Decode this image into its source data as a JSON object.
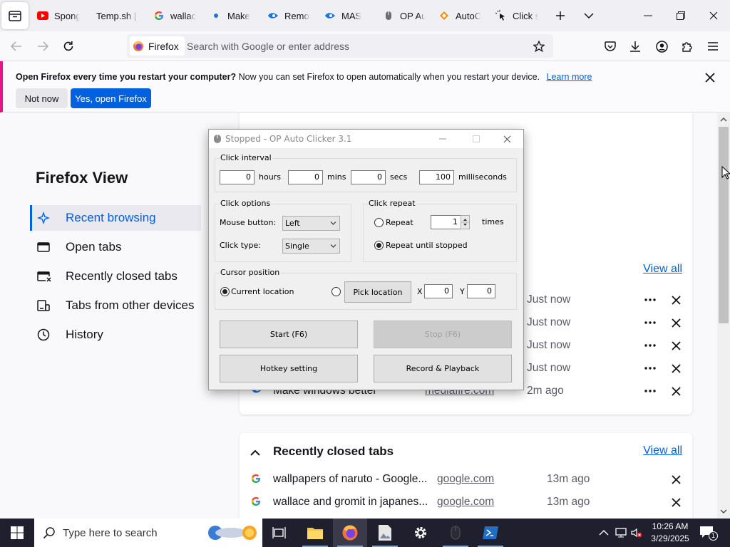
{
  "tabs": [
    {
      "title": "SpongeBob",
      "icon": "youtube-icon"
    },
    {
      "title": "Temp.sh | F",
      "icon": "blank-icon"
    },
    {
      "title": "wallace",
      "icon": "google-icon"
    },
    {
      "title": "Make",
      "icon": "mediafire-icon"
    },
    {
      "title": "Remove",
      "icon": "mediafire-icon"
    },
    {
      "title": "MAS",
      "icon": "mediafire-icon"
    },
    {
      "title": "OP Auto",
      "icon": "mouse-icon"
    },
    {
      "title": "AutoClicker",
      "icon": "diamond-icon"
    },
    {
      "title": "Click s",
      "icon": "cursor-click-icon"
    }
  ],
  "navbar": {
    "identity_label": "Firefox",
    "url_placeholder": "Search with Google or enter address"
  },
  "notification": {
    "bold_text": "Open Firefox every time you restart your computer?",
    "text": "Now you can set Firefox to open automatically when you restart your device.",
    "learn_more": "Learn more",
    "not_now": "Not now",
    "yes_open": "Yes, open Firefox"
  },
  "firefox_view": {
    "title": "Firefox View",
    "nav": [
      {
        "label": "Recent browsing",
        "icon": "sparkle-icon",
        "active": true
      },
      {
        "label": "Open tabs",
        "icon": "tab-icon",
        "active": false
      },
      {
        "label": "Recently closed tabs",
        "icon": "closed-tab-icon",
        "active": false
      },
      {
        "label": "Tabs from other devices",
        "icon": "devices-icon",
        "active": false
      },
      {
        "label": "History",
        "icon": "clock-icon",
        "active": false
      }
    ],
    "open_tabs": {
      "view_all": "View all",
      "rows": [
        {
          "title": "",
          "url": "",
          "time": "Just now"
        },
        {
          "title": "",
          "url": "",
          "time": "Just now"
        },
        {
          "title": "",
          "url": "",
          "time": "Just now"
        },
        {
          "title": "",
          "url": "",
          "time": "Just now"
        },
        {
          "title": "Make windows better",
          "url": "mediafire.com",
          "time": "2m ago"
        }
      ]
    },
    "recently_closed": {
      "heading": "Recently closed tabs",
      "view_all": "View all",
      "rows": [
        {
          "title": "wallpapers of naruto - Google...",
          "url": "google.com",
          "time": "13m ago"
        },
        {
          "title": "wallace and gromit in japanes...",
          "url": "google.com",
          "time": "13m ago"
        }
      ]
    }
  },
  "autoclicker": {
    "title": "Stopped - OP Auto Clicker 3.1",
    "click_interval": {
      "label": "Click interval",
      "hours": "0",
      "hours_label": "hours",
      "mins": "0",
      "mins_label": "mins",
      "secs": "0",
      "secs_label": "secs",
      "ms": "100",
      "ms_label": "milliseconds"
    },
    "click_options": {
      "label": "Click options",
      "mouse_button_label": "Mouse button:",
      "mouse_button": "Left",
      "click_type_label": "Click type:",
      "click_type": "Single"
    },
    "click_repeat": {
      "label": "Click repeat",
      "repeat_label": "Repeat",
      "repeat_count": "1",
      "times_label": "times",
      "until_stopped_label": "Repeat until stopped"
    },
    "cursor_position": {
      "label": "Cursor position",
      "current_label": "Current location",
      "pick_label": "Pick location",
      "x_label": "X",
      "x": "0",
      "y_label": "Y",
      "y": "0"
    },
    "start_label": "Start (F6)",
    "stop_label": "Stop (F6)",
    "hotkey_label": "Hotkey setting",
    "record_label": "Record & Playback"
  },
  "taskbar": {
    "search_placeholder": "Type here to search",
    "time": "10:26 AM",
    "date": "3/29/2025",
    "notification_count": "1"
  },
  "colors": {
    "accent": "#0061e0",
    "notification_stripe": "#e31587",
    "taskbar": "#1f1f2e"
  }
}
